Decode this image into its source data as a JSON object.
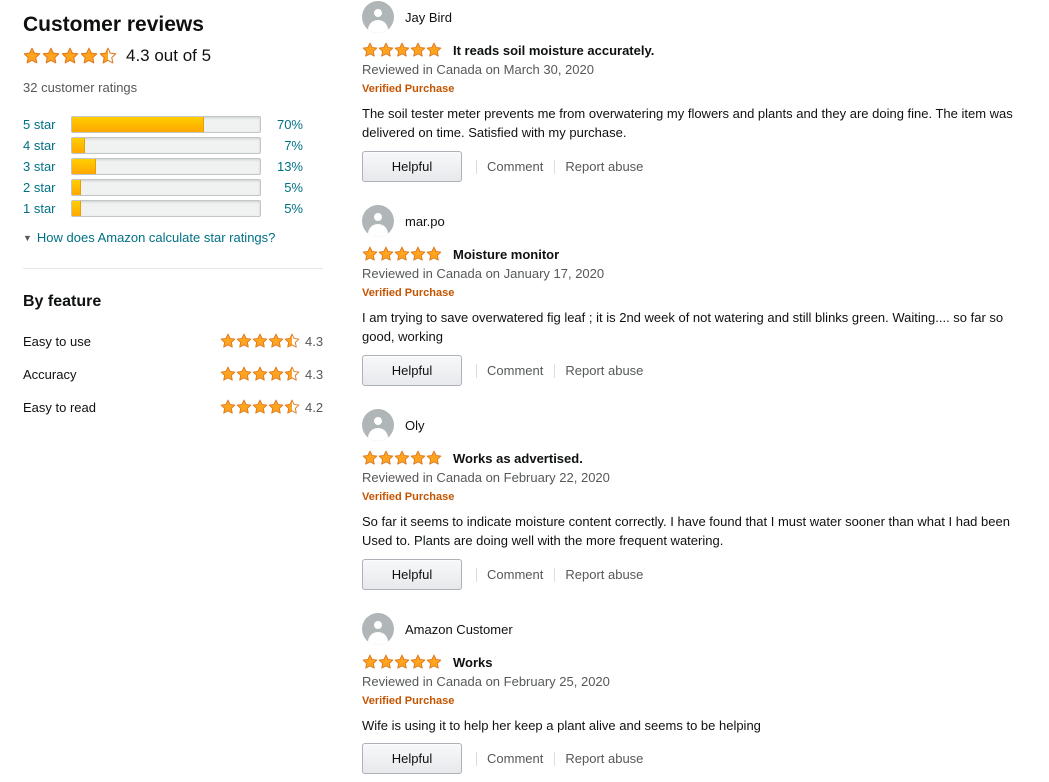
{
  "summary": {
    "title": "Customer reviews",
    "overall_rating": 4.3,
    "overall_text": "4.3 out of 5",
    "ratings_count_text": "32 customer ratings"
  },
  "histogram": [
    {
      "label": "5 star",
      "percent": 70,
      "percent_text": "70%"
    },
    {
      "label": "4 star",
      "percent": 7,
      "percent_text": "7%"
    },
    {
      "label": "3 star",
      "percent": 13,
      "percent_text": "13%"
    },
    {
      "label": "2 star",
      "percent": 5,
      "percent_text": "5%"
    },
    {
      "label": "1 star",
      "percent": 5,
      "percent_text": "5%"
    }
  ],
  "calc_link": "How does Amazon calculate star ratings?",
  "by_feature": {
    "title": "By feature",
    "items": [
      {
        "name": "Easy to use",
        "rating": 4.3,
        "rating_text": "4.3"
      },
      {
        "name": "Accuracy",
        "rating": 4.3,
        "rating_text": "4.3"
      },
      {
        "name": "Easy to read",
        "rating": 4.2,
        "rating_text": "4.2"
      }
    ]
  },
  "reviews": [
    {
      "reviewer": "Jay Bird",
      "rating": 5,
      "title": "It reads soil moisture accurately.",
      "date": "Reviewed in Canada on March 30, 2020",
      "verified": "Verified Purchase",
      "body": "The soil tester meter prevents me from overwatering my flowers and plants and they are doing fine. The item was delivered on time. Satisfied with my purchase."
    },
    {
      "reviewer": "mar.po",
      "rating": 5,
      "title": "Moisture monitor",
      "date": "Reviewed in Canada on January 17, 2020",
      "verified": "Verified Purchase",
      "body": "I am trying to save overwatered fig leaf ; it is 2nd week of not watering and still blinks green. Waiting.... so far so good, working"
    },
    {
      "reviewer": "Oly",
      "rating": 5,
      "title": "Works as advertised.",
      "date": "Reviewed in Canada on February 22, 2020",
      "verified": "Verified Purchase",
      "body": "So far it seems to indicate moisture content correctly. I have found that I must water sooner than what I had been Used to. Plants are doing well with the more frequent watering."
    },
    {
      "reviewer": "Amazon Customer",
      "rating": 5,
      "title": "Works",
      "date": "Reviewed in Canada on February 25, 2020",
      "verified": "Verified Purchase",
      "body": "Wife is using it to help her keep a plant alive and seems to be helping"
    }
  ],
  "actions": {
    "helpful": "Helpful",
    "comment": "Comment",
    "report": "Report abuse"
  },
  "colors": {
    "star_fill": "#ffa41c",
    "star_stroke": "#de7921",
    "link": "#007185",
    "verified": "#c45500"
  },
  "icons": {
    "star": "star-icon",
    "avatar": "avatar-icon",
    "chevron": "chevron-down-icon"
  }
}
